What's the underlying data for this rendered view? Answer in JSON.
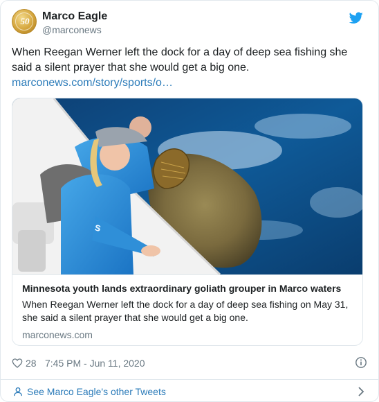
{
  "account": {
    "name": "Marco Eagle",
    "handle": "@marconews",
    "avatar_text": "50"
  },
  "tweet": {
    "text": "When Reegan Werner left the dock for a day of deep sea fishing she said a silent prayer that she would get a big one.",
    "link": "marconews.com/story/sports/o…"
  },
  "card": {
    "title": "Minnesota youth lands extraordinary goliath grouper in Marco waters",
    "description": "When Reegan Werner left the dock for a day of deep sea fishing on May 31, she said a silent prayer that she would get a big one.",
    "domain": "marconews.com"
  },
  "meta": {
    "likes": "28",
    "timestamp": "7:45 PM - Jun 11, 2020"
  },
  "footer": {
    "label": "See Marco Eagle's other Tweets"
  },
  "colors": {
    "link": "#2b7bb9",
    "muted": "#697882",
    "twitter_blue": "#1da1f2"
  },
  "icons": [
    "twitter-bird-icon",
    "heart-icon",
    "info-icon",
    "person-icon",
    "chevron-right-icon"
  ]
}
